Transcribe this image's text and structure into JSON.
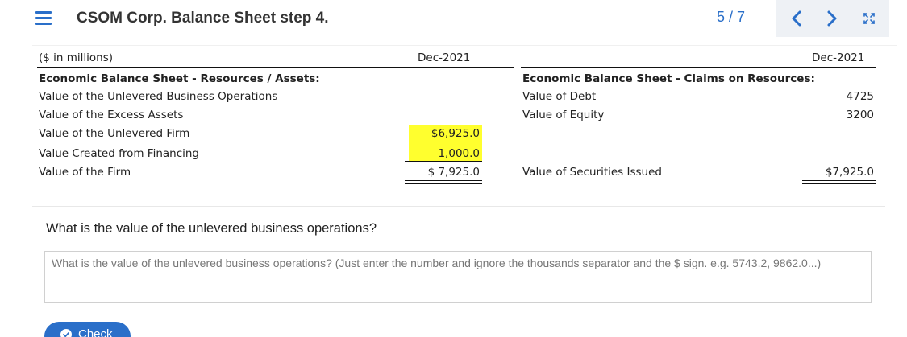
{
  "header": {
    "title": "CSOM Corp. Balance Sheet step 4.",
    "page_indicator": "5 / 7",
    "accent_color": "#2a6fc9"
  },
  "sheet": {
    "units_label": "($ in millions)",
    "left_date_header": "Dec-2021",
    "right_date_header": "Dec-2021",
    "assets_heading": "Economic Balance Sheet - Resources / Assets:",
    "claims_heading": "Economic Balance Sheet - Claims on Resources:",
    "assets_rows": [
      {
        "label": "Value of the Unlevered Business Operations",
        "value": ""
      },
      {
        "label": "Value of the Excess Assets",
        "value": ""
      },
      {
        "label": "Value of the Unlevered Firm",
        "value": "$6,925.0"
      },
      {
        "label": "Value Created from Financing",
        "value": "1,000.0"
      },
      {
        "label": "Value of the Firm",
        "value": "$ 7,925.0"
      }
    ],
    "claims_rows": [
      {
        "label": "Value of Debt",
        "value": "4725"
      },
      {
        "label": "Value of Equity",
        "value": "3200"
      }
    ],
    "securities_label": "Value of Securities Issued",
    "securities_value": "$7,925.0",
    "highlight_color": "#ffff2e"
  },
  "question": {
    "text": "What is the value of the unlevered business operations?",
    "answer_placeholder": "What is the value of the unlevered business operations? (Just enter the number and ignore the thousands separator and the $ sign. e.g. 5743.2, 9862.0...)",
    "answer_value": ""
  },
  "actions": {
    "check_label": "Check"
  },
  "icons": {
    "menu": "hamburger-menu-icon",
    "prev": "chevron-left-icon",
    "next": "chevron-right-icon",
    "expand": "expand-arrows-icon",
    "check": "checkmark-circle-icon"
  }
}
